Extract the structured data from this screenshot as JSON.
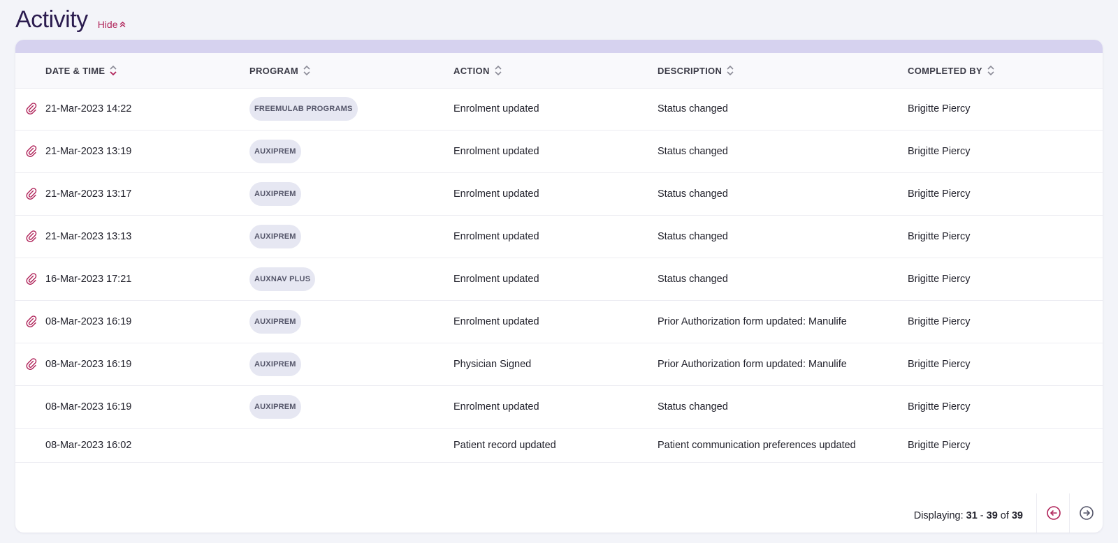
{
  "header": {
    "title": "Activity",
    "hide_label": "Hide"
  },
  "table": {
    "columns": [
      {
        "key": "date",
        "label": "DATE & TIME",
        "sorted": "desc"
      },
      {
        "key": "program",
        "label": "PROGRAM"
      },
      {
        "key": "action",
        "label": "ACTION"
      },
      {
        "key": "description",
        "label": "DESCRIPTION"
      },
      {
        "key": "completed_by",
        "label": "COMPLETED BY"
      }
    ],
    "rows": [
      {
        "attachment": true,
        "date": "21-Mar-2023 14:22",
        "program": "FREEMULAB PROGRAMS",
        "action": "Enrolment updated",
        "description": "Status changed",
        "completed_by": "Brigitte Piercy"
      },
      {
        "attachment": true,
        "date": "21-Mar-2023 13:19",
        "program": "AUXIPREM",
        "action": "Enrolment updated",
        "description": "Status changed",
        "completed_by": "Brigitte Piercy"
      },
      {
        "attachment": true,
        "date": "21-Mar-2023 13:17",
        "program": "AUXIPREM",
        "action": "Enrolment updated",
        "description": "Status changed",
        "completed_by": "Brigitte Piercy"
      },
      {
        "attachment": true,
        "date": "21-Mar-2023 13:13",
        "program": "AUXIPREM",
        "action": "Enrolment updated",
        "description": "Status changed",
        "completed_by": "Brigitte Piercy"
      },
      {
        "attachment": true,
        "date": "16-Mar-2023 17:21",
        "program": "AUXNAV PLUS",
        "action": "Enrolment updated",
        "description": "Status changed",
        "completed_by": "Brigitte Piercy"
      },
      {
        "attachment": true,
        "date": "08-Mar-2023 16:19",
        "program": "AUXIPREM",
        "action": "Enrolment updated",
        "description": "Prior Authorization form updated: Manulife",
        "completed_by": "Brigitte Piercy"
      },
      {
        "attachment": true,
        "date": "08-Mar-2023 16:19",
        "program": "AUXIPREM",
        "action": "Physician Signed",
        "description": "Prior Authorization form updated: Manulife",
        "completed_by": "Brigitte Piercy"
      },
      {
        "attachment": false,
        "date": "08-Mar-2023 16:19",
        "program": "AUXIPREM",
        "action": "Enrolment updated",
        "description": "Status changed",
        "completed_by": "Brigitte Piercy"
      },
      {
        "attachment": false,
        "date": "08-Mar-2023 16:02",
        "program": "",
        "action": "Patient record updated",
        "description": "Patient communication preferences updated",
        "completed_by": "Brigitte Piercy"
      }
    ]
  },
  "pagination": {
    "prefix": "Displaying:",
    "from": "31",
    "dash": "-",
    "to": "39",
    "of_label": "of",
    "total": "39"
  },
  "icons": {
    "attachment": "paperclip-icon",
    "prev": "arrow-left-circle-icon",
    "next": "arrow-right-circle-icon",
    "hide": "chevrons-up-icon"
  },
  "colors": {
    "accent": "#b0245a",
    "title": "#2b1c4f",
    "card_band": "#d6d2ef",
    "badge_bg": "#e6e7f2"
  }
}
